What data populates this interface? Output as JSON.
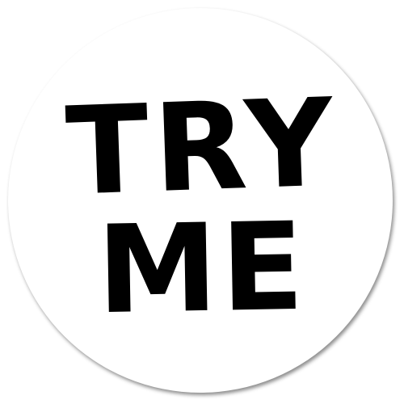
{
  "sticker": {
    "line1": "TRY",
    "line2": "ME",
    "background_color": "#ffffff",
    "text_color": "#000000"
  }
}
